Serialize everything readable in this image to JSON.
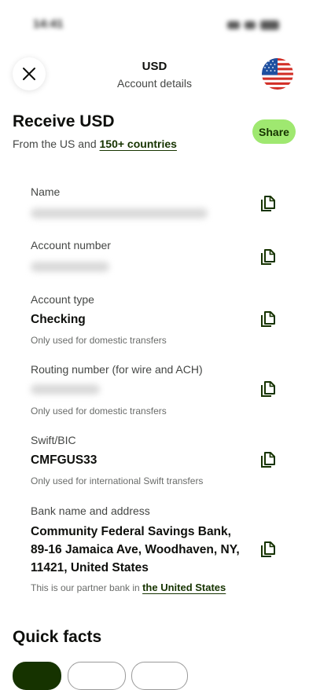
{
  "status": {
    "time": "14:41"
  },
  "header": {
    "title": "USD",
    "subtitle": "Account details"
  },
  "receive": {
    "title": "Receive USD",
    "subtitle_prefix": "From the US and ",
    "subtitle_link": "150+ countries",
    "share_label": "Share"
  },
  "fields": {
    "name": {
      "label": "Name"
    },
    "account_number": {
      "label": "Account number"
    },
    "account_type": {
      "label": "Account type",
      "value": "Checking",
      "note": "Only used for domestic transfers"
    },
    "routing": {
      "label": "Routing number (for wire and ACH)",
      "note": "Only used for domestic transfers"
    },
    "swift": {
      "label": "Swift/BIC",
      "value": "CMFGUS33",
      "note": "Only used for international Swift transfers"
    },
    "bank": {
      "label": "Bank name and address",
      "value": "Community Federal Savings Bank, 89-16 Jamaica Ave, Woodhaven, NY, 11421, United States",
      "note_prefix": "This is our partner bank in ",
      "note_link": "the United States"
    }
  },
  "quick_facts": {
    "title": "Quick facts"
  },
  "colors": {
    "accent": "#9fe870",
    "forest": "#163300"
  },
  "icons": {
    "close": "close-icon",
    "copy": "copy-icon",
    "flag": "us-flag-icon"
  }
}
